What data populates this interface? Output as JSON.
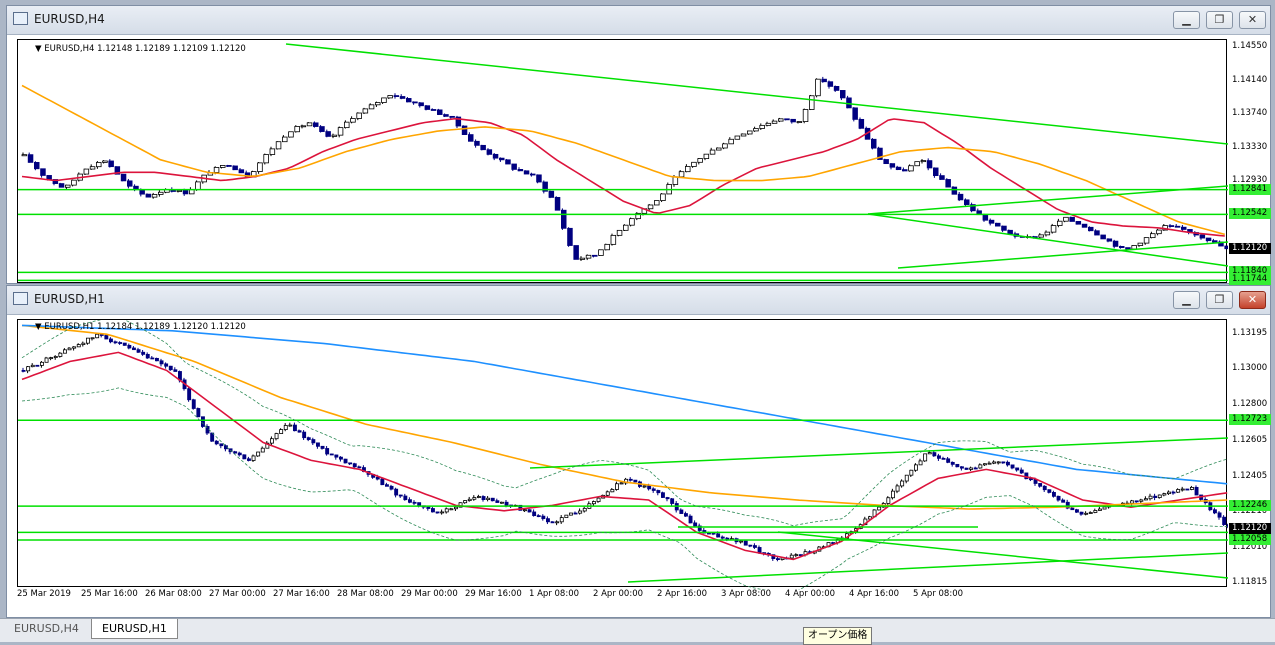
{
  "windows": [
    {
      "id": "h4",
      "title": "EURUSD,H4",
      "info_symbol": "EURUSD,H4",
      "info_prices": "1.12148 1.12189 1.12109 1.12120",
      "price_labels": [
        {
          "price": 1.1455,
          "text": "1.14550"
        },
        {
          "price": 1.1414,
          "text": "1.14140"
        },
        {
          "price": 1.1374,
          "text": "1.13740"
        },
        {
          "price": 1.1333,
          "text": "1.13330"
        },
        {
          "price": 1.1293,
          "text": "1.12930"
        }
      ],
      "highlight_labels": [
        {
          "price": 1.12841,
          "text": "1.12841"
        },
        {
          "price": 1.12542,
          "text": "1.12542"
        },
        {
          "price": 1.1184,
          "text": "1.11840"
        },
        {
          "price": 1.11744,
          "text": "1.11744"
        }
      ],
      "current_price": {
        "price": 1.1212,
        "text": "1.12120"
      }
    },
    {
      "id": "h1",
      "title": "EURUSD,H1",
      "info_symbol": "EURUSD,H1",
      "info_prices": "1.12184 1.12189 1.12120 1.12120",
      "price_labels": [
        {
          "price": 1.13195,
          "text": "1.13195"
        },
        {
          "price": 1.13,
          "text": "1.13000"
        },
        {
          "price": 1.128,
          "text": "1.12800"
        },
        {
          "price": 1.12605,
          "text": "1.12605"
        },
        {
          "price": 1.12405,
          "text": "1.12405"
        },
        {
          "price": 1.1221,
          "text": "1.12210"
        },
        {
          "price": 1.1201,
          "text": "1.12010"
        },
        {
          "price": 1.11815,
          "text": "1.11815"
        }
      ],
      "highlight_labels": [
        {
          "price": 1.12723,
          "text": "1.12723"
        },
        {
          "price": 1.12246,
          "text": "1.12246"
        },
        {
          "price": 1.121,
          "text": "1.12100"
        },
        {
          "price": 1.12058,
          "text": "1.12058"
        }
      ],
      "current_price": {
        "price": 1.1212,
        "text": "1.12120"
      },
      "time_labels": [
        "25 Mar 2019",
        "25 Mar 16:00",
        "26 Mar 08:00",
        "27 Mar 00:00",
        "27 Mar 16:00",
        "28 Mar 08:00",
        "29 Mar 00:00",
        "29 Mar 16:00",
        "1 Apr 08:00",
        "2 Apr 00:00",
        "2 Apr 16:00",
        "3 Apr 08:00",
        "4 Apr 00:00",
        "4 Apr 16:00",
        "5 Apr 08:00"
      ]
    }
  ],
  "tabs": [
    {
      "label": "EURUSD,H4",
      "active": false
    },
    {
      "label": "EURUSD,H1",
      "active": true
    }
  ],
  "tooltip": "オープン価格",
  "colors": {
    "bull_candle": "#000000",
    "bear_candle": "#000080",
    "ma_fast": "#dc143c",
    "ma_mid": "#ffa500",
    "ma_slow": "#1e90ff",
    "lines": "#00e000"
  },
  "chart_data": [
    {
      "type": "candlestick",
      "symbol": "EURUSD",
      "timeframe": "H4",
      "ylim": [
        1.117,
        1.1465
      ],
      "close_path": [
        1.1325,
        1.13,
        1.1285,
        1.131,
        1.132,
        1.129,
        1.1275,
        1.1285,
        1.128,
        1.1305,
        1.1315,
        1.13,
        1.133,
        1.1355,
        1.1365,
        1.1345,
        1.137,
        1.1385,
        1.14,
        1.139,
        1.138,
        1.137,
        1.134,
        1.1325,
        1.131,
        1.13,
        1.127,
        1.12,
        1.1205,
        1.123,
        1.1255,
        1.127,
        1.13,
        1.132,
        1.1335,
        1.135,
        1.136,
        1.137,
        1.1365,
        1.142,
        1.14,
        1.136,
        1.132,
        1.1305,
        1.132,
        1.1295,
        1.127,
        1.125,
        1.1235,
        1.1225,
        1.123,
        1.125,
        1.124,
        1.1225,
        1.121,
        1.1225,
        1.124,
        1.1235,
        1.1225,
        1.1212
      ],
      "ma_fast_path": [
        1.13,
        1.1295,
        1.13,
        1.1305,
        1.1305,
        1.13,
        1.1295,
        1.13,
        1.131,
        1.133,
        1.1345,
        1.1355,
        1.1365,
        1.137,
        1.1365,
        1.135,
        1.132,
        1.1295,
        1.127,
        1.1255,
        1.1265,
        1.129,
        1.131,
        1.132,
        1.133,
        1.1345,
        1.137,
        1.1365,
        1.134,
        1.131,
        1.1285,
        1.126,
        1.1245,
        1.124,
        1.1238,
        1.1232,
        1.1228
      ],
      "ma_mid_path": [
        1.141,
        1.138,
        1.135,
        1.132,
        1.1305,
        1.13,
        1.131,
        1.133,
        1.1345,
        1.1355,
        1.136,
        1.1355,
        1.134,
        1.132,
        1.13,
        1.1295,
        1.1295,
        1.13,
        1.1315,
        1.133,
        1.1335,
        1.133,
        1.1315,
        1.1295,
        1.127,
        1.1245,
        1.123
      ],
      "horizontal_lines": [
        1.12841,
        1.12542,
        1.1184,
        1.11744
      ],
      "trend_lines": 4
    },
    {
      "type": "candlestick",
      "symbol": "EURUSD",
      "timeframe": "H1",
      "ylim": [
        1.1178,
        1.1328
      ],
      "x": [
        "25 Mar 2019",
        "25 Mar 16:00",
        "26 Mar 08:00",
        "27 Mar 00:00",
        "27 Mar 16:00",
        "28 Mar 08:00",
        "29 Mar 00:00",
        "29 Mar 16:00",
        "1 Apr 08:00",
        "2 Apr 00:00",
        "2 Apr 16:00",
        "3 Apr 08:00",
        "4 Apr 00:00",
        "4 Apr 16:00",
        "5 Apr 08:00"
      ],
      "close_path": [
        1.13,
        1.131,
        1.132,
        1.131,
        1.13,
        1.126,
        1.125,
        1.127,
        1.1255,
        1.1245,
        1.123,
        1.122,
        1.123,
        1.1225,
        1.1215,
        1.1225,
        1.124,
        1.123,
        1.121,
        1.1205,
        1.1195,
        1.12,
        1.121,
        1.123,
        1.1255,
        1.1245,
        1.125,
        1.1235,
        1.122,
        1.1225,
        1.123,
        1.1235,
        1.1212
      ],
      "ma_fast_path": [
        1.1295,
        1.1305,
        1.131,
        1.13,
        1.128,
        1.126,
        1.125,
        1.1245,
        1.1235,
        1.1225,
        1.1222,
        1.1225,
        1.123,
        1.1228,
        1.121,
        1.12,
        1.1195,
        1.1205,
        1.1225,
        1.124,
        1.1245,
        1.124,
        1.1228,
        1.1224,
        1.1228,
        1.1232
      ],
      "ma_mid_path": [
        1.1325,
        1.132,
        1.1305,
        1.1285,
        1.127,
        1.126,
        1.1248,
        1.1238,
        1.1232,
        1.1228,
        1.1225,
        1.1223,
        1.1224,
        1.1226,
        1.1228
      ],
      "ma_slow_path": [
        1.1325,
        1.1322,
        1.1315,
        1.1305,
        1.129,
        1.1275,
        1.126,
        1.1245,
        1.1237
      ],
      "horizontal_lines": [
        1.12723,
        1.12246,
        1.121,
        1.12058
      ],
      "trend_lines": 4
    }
  ]
}
